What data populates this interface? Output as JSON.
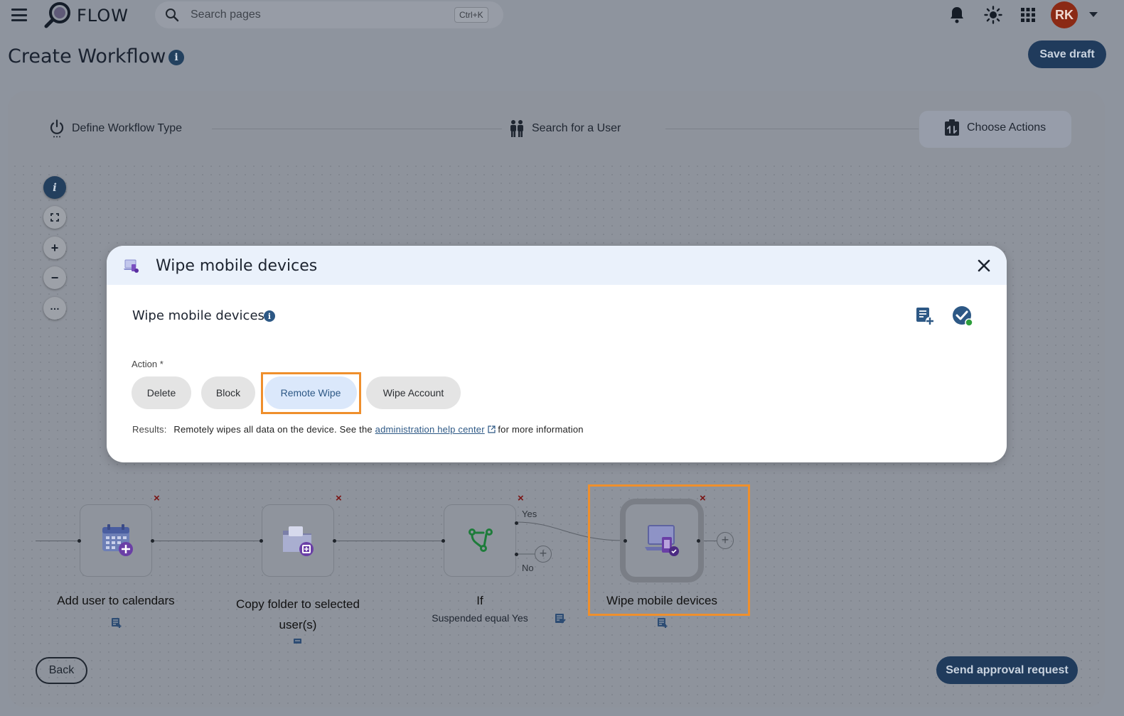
{
  "app": {
    "name": "FLOW"
  },
  "search": {
    "placeholder": "Search pages",
    "shortcut": "Ctrl+K"
  },
  "user": {
    "initials": "RK"
  },
  "page": {
    "title": "Create Workflow",
    "save_label": "Save draft"
  },
  "steps": [
    {
      "label": "Define Workflow Type",
      "icon": "power-icon"
    },
    {
      "label": "Search for a User",
      "icon": "users-icon"
    },
    {
      "label": "Choose Actions",
      "icon": "actions-icon",
      "active": true
    }
  ],
  "canvas_controls": [
    "info",
    "fit-view",
    "zoom-in",
    "zoom-out",
    "more"
  ],
  "nodes": [
    {
      "label": "Add user to calendars",
      "icon": "calendar-add-icon"
    },
    {
      "label": "Copy folder to selected user(s)",
      "icon": "folder-copy-icon"
    },
    {
      "label": "If",
      "sub": "Suspended equal Yes",
      "icon": "branch-icon",
      "branches": [
        "Yes",
        "No"
      ]
    },
    {
      "label": "Wipe mobile devices",
      "icon": "device-wipe-icon",
      "highlighted": true
    }
  ],
  "footer": {
    "back_label": "Back",
    "send_label": "Send approval request"
  },
  "modal": {
    "title": "Wipe mobile devices",
    "subtitle": "Wipe mobile devices",
    "action_label": "Action *",
    "actions": [
      "Delete",
      "Block",
      "Remote Wipe",
      "Wipe Account"
    ],
    "selected_action": "Remote Wipe",
    "results_label": "Results:",
    "results_text_before": "Remotely wipes all data on the device. See the",
    "results_link": "administration help center",
    "results_text_after": "for more information"
  },
  "colors": {
    "primary": "#203b5c",
    "highlight": "#ef8f2c",
    "chip_selected_bg": "#dbe8fb",
    "avatar": "#8b2a15"
  }
}
